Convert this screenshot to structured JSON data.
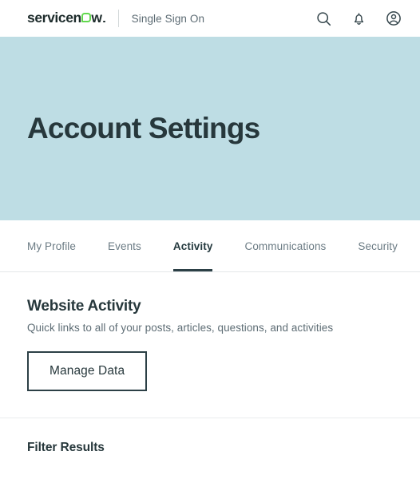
{
  "topbar": {
    "logo": {
      "pre": "servicen",
      "post": "w",
      "icon": "servicenow-logo",
      "ring_color": "#62d84e"
    },
    "brand_sub": "Single Sign On",
    "actions": [
      {
        "name": "search-icon",
        "label": "Search"
      },
      {
        "name": "bell-icon",
        "label": "Notifications"
      },
      {
        "name": "user-account-icon",
        "label": "Account"
      }
    ]
  },
  "hero": {
    "title": "Account Settings",
    "background": "#bedde4",
    "title_color": "#27383c"
  },
  "tabs": [
    {
      "label": "My Profile",
      "active": false
    },
    {
      "label": "Events",
      "active": false
    },
    {
      "label": "Activity",
      "active": true
    },
    {
      "label": "Communications",
      "active": false
    },
    {
      "label": "Security",
      "active": false
    }
  ],
  "main": {
    "section_title": "Website Activity",
    "section_sub": "Quick links to all of your posts, articles, questions, and activities",
    "manage_data_label": "Manage Data"
  },
  "filter": {
    "title": "Filter Results"
  }
}
